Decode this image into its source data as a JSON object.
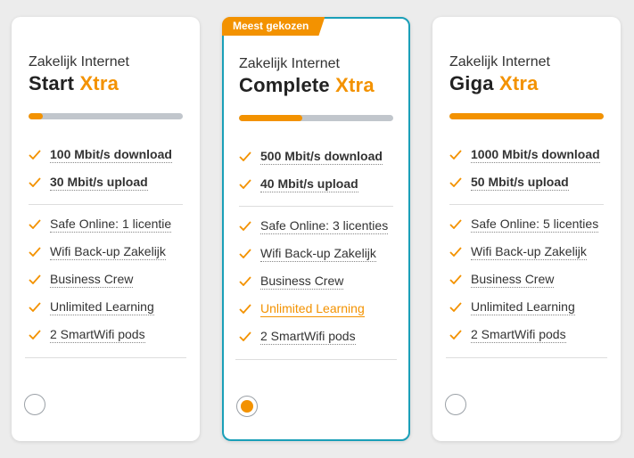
{
  "colors": {
    "accent": "#f39200",
    "selected_border": "#1a9fb8",
    "bar_track": "#c1c6cc"
  },
  "plans": [
    {
      "product": "Zakelijk Internet",
      "name": "Start",
      "suffix": "Xtra",
      "speed_level": 0.09,
      "badge": "",
      "selected": false,
      "features": [
        "100 Mbit/s download",
        "30 Mbit/s upload"
      ],
      "extras": [
        "Safe Online: 1 licentie",
        "Wifi Back-up Zakelijk",
        "Business Crew",
        "Unlimited Learning",
        "2 SmartWifi pods"
      ]
    },
    {
      "product": "Zakelijk Internet",
      "name": "Complete",
      "suffix": "Xtra",
      "speed_level": 0.41,
      "badge": "Meest gekozen",
      "selected": true,
      "features": [
        "500 Mbit/s download",
        "40 Mbit/s upload"
      ],
      "extras": [
        "Safe Online: 3 licenties",
        "Wifi Back-up Zakelijk",
        "Business Crew",
        "Unlimited Learning",
        "2 SmartWifi pods"
      ]
    },
    {
      "product": "Zakelijk Internet",
      "name": "Giga",
      "suffix": "Xtra",
      "speed_level": 1.0,
      "badge": "",
      "selected": false,
      "features": [
        "1000 Mbit/s download",
        "50 Mbit/s upload"
      ],
      "extras": [
        "Safe Online: 5 licenties",
        "Wifi Back-up Zakelijk",
        "Business Crew",
        "Unlimited Learning",
        "2 SmartWifi pods"
      ]
    }
  ]
}
